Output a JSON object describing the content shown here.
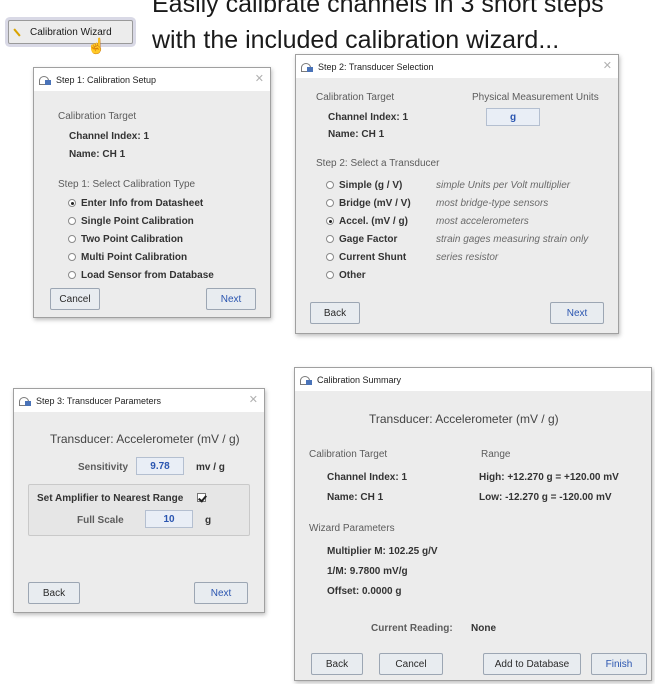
{
  "headline": {
    "line1": "Easily calibrate channels in 3 short steps",
    "line2": "with the included calibration wizard..."
  },
  "wizard_button": {
    "label": "Calibration Wizard"
  },
  "step1": {
    "title": "Step 1: Calibration Setup",
    "calibration_target_label": "Calibration Target",
    "channel_index": "Channel Index: 1",
    "name": "Name: CH 1",
    "select_type_label": "Step 1: Select Calibration Type",
    "options": [
      {
        "label": "Enter Info from Datasheet",
        "selected": true
      },
      {
        "label": "Single Point Calibration",
        "selected": false
      },
      {
        "label": "Two Point Calibration",
        "selected": false
      },
      {
        "label": "Multi Point Calibration",
        "selected": false
      },
      {
        "label": "Load Sensor from Database",
        "selected": false
      }
    ],
    "cancel_label": "Cancel",
    "next_label": "Next"
  },
  "step2": {
    "title": "Step 2: Transducer Selection",
    "calibration_target_label": "Calibration Target",
    "physical_units_label": "Physical Measurement Units",
    "units_value": "g",
    "channel_index": "Channel Index: 1",
    "name": "Name: CH 1",
    "select_label": "Step 2: Select a Transducer",
    "options": [
      {
        "label": "Simple (g / V)",
        "desc": "simple Units per Volt multiplier",
        "selected": false
      },
      {
        "label": "Bridge (mV / V)",
        "desc": "most bridge-type sensors",
        "selected": false
      },
      {
        "label": "Accel. (mV / g)",
        "desc": "most accelerometers",
        "selected": true
      },
      {
        "label": "Gage Factor",
        "desc": "strain gages measuring strain only",
        "selected": false
      },
      {
        "label": "Current Shunt",
        "desc": "series resistor",
        "selected": false
      },
      {
        "label": "Other",
        "desc": "",
        "selected": false
      }
    ],
    "back_label": "Back",
    "next_label": "Next"
  },
  "step3": {
    "title": "Step 3: Transducer Parameters",
    "transducer_heading": "Transducer: Accelerometer (mV / g)",
    "sensitivity_label": "Sensitivity",
    "sensitivity_value": "9.78",
    "sensitivity_unit": "mv / g",
    "amplifier_label": "Set Amplifier to Nearest Range",
    "amplifier_checked": true,
    "full_scale_label": "Full Scale",
    "full_scale_value": "10",
    "full_scale_unit": "g",
    "back_label": "Back",
    "next_label": "Next"
  },
  "summary": {
    "title": "Calibration Summary",
    "transducer_heading": "Transducer: Accelerometer (mV / g)",
    "calibration_target_label": "Calibration Target",
    "range_label": "Range",
    "channel_index": "Channel Index: 1",
    "name": "Name: CH 1",
    "high": "High: +12.270 g = +120.00 mV",
    "low": "Low: -12.270 g = -120.00 mV",
    "wizard_params_label": "Wizard Parameters",
    "multiplier": "Multiplier M: 102.25 g/V",
    "inverse_m": "1/M: 9.7800 mV/g",
    "offset": "Offset: 0.0000 g",
    "current_reading_label": "Current Reading:",
    "current_reading_value": "None",
    "back_label": "Back",
    "cancel_label": "Cancel",
    "add_label": "Add to Database",
    "finish_label": "Finish"
  },
  "colors": {
    "accent_blue": "#2a55b0",
    "window_bg": "#ececec",
    "field_bg": "#e9eef6"
  },
  "icons": [
    "wand-icon",
    "hand-cursor-icon",
    "window-icon",
    "close-icon",
    "radio-button",
    "checkbox"
  ]
}
